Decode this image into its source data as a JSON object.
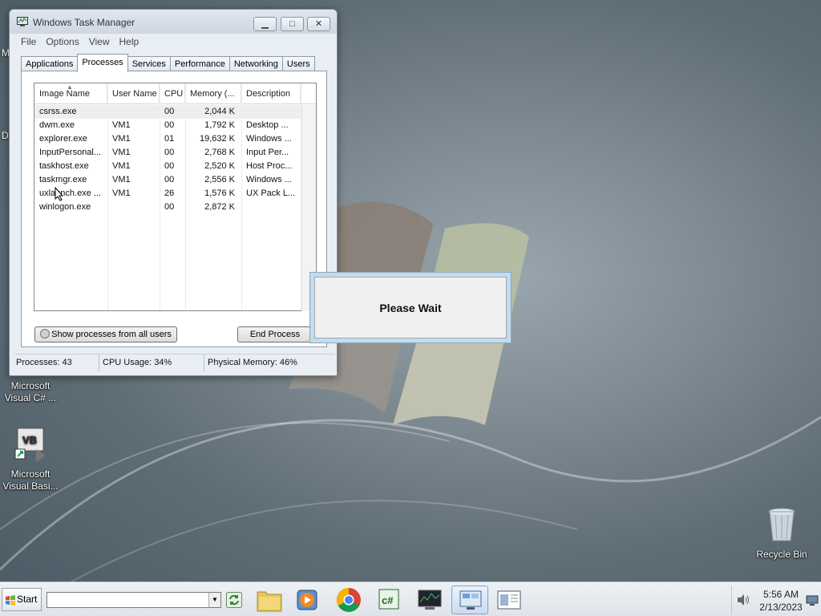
{
  "window": {
    "title": "Windows Task Manager",
    "minimize_label": "▁",
    "maximize_label": "□",
    "close_label": "✕"
  },
  "menu": [
    "File",
    "Options",
    "View",
    "Help"
  ],
  "tabs": [
    {
      "label": "Applications",
      "active": false
    },
    {
      "label": "Processes",
      "active": true
    },
    {
      "label": "Services",
      "active": false
    },
    {
      "label": "Performance",
      "active": false
    },
    {
      "label": "Networking",
      "active": false
    },
    {
      "label": "Users",
      "active": false
    }
  ],
  "process_table": {
    "columns": [
      "Image Name",
      "User Name",
      "CPU",
      "Memory (...",
      "Description"
    ],
    "sort_indicator": "▲",
    "rows": [
      {
        "name": "csrss.exe",
        "user": "",
        "cpu": "00",
        "memory": "2,044 K",
        "description": ""
      },
      {
        "name": "dwm.exe",
        "user": "VM1",
        "cpu": "00",
        "memory": "1,792 K",
        "description": "Desktop ..."
      },
      {
        "name": "explorer.exe",
        "user": "VM1",
        "cpu": "01",
        "memory": "19,632 K",
        "description": "Windows ..."
      },
      {
        "name": "InputPersonal...",
        "user": "VM1",
        "cpu": "00",
        "memory": "2,768 K",
        "description": "Input Per..."
      },
      {
        "name": "taskhost.exe",
        "user": "VM1",
        "cpu": "00",
        "memory": "2,520 K",
        "description": "Host Proc..."
      },
      {
        "name": "taskmgr.exe",
        "user": "VM1",
        "cpu": "00",
        "memory": "2,556 K",
        "description": "Windows ..."
      },
      {
        "name": "uxlaunch.exe ...",
        "user": "VM1",
        "cpu": "26",
        "memory": "1,576 K",
        "description": "UX Pack L..."
      },
      {
        "name": "winlogon.exe",
        "user": "",
        "cpu": "00",
        "memory": "2,872 K",
        "description": ""
      }
    ]
  },
  "buttons": {
    "show_all": "Show processes from all users",
    "end_process": "End Process"
  },
  "status": {
    "processes": "Processes: 43",
    "cpu": "CPU Usage: 34%",
    "memory": "Physical Memory: 46%"
  },
  "dialog": {
    "text": "Please Wait"
  },
  "desktop": {
    "icons": [
      {
        "label_line1": "Microsoft",
        "label_line2": "Visual C# ..."
      },
      {
        "label_line1": "Microsoft",
        "label_line2": "Visual Basi..."
      },
      {
        "label_line1": "Recycle Bin",
        "label_line2": ""
      }
    ],
    "edge_letters": [
      "M",
      "D"
    ]
  },
  "taskbar": {
    "start_label": "Start",
    "address_value": "",
    "dropdown_glyph": "▼",
    "apps": [
      {
        "icon": "folder-icon",
        "active": false
      },
      {
        "icon": "media-player-icon",
        "active": false
      },
      {
        "icon": "chrome-icon",
        "active": false
      },
      {
        "icon": "csharp-icon",
        "active": false
      },
      {
        "icon": "task-manager-icon",
        "active": false
      },
      {
        "icon": "remote-desktop-icon",
        "active": true
      },
      {
        "icon": "document-icon",
        "active": false
      }
    ],
    "clock_time": "5:56 AM",
    "clock_date": "2/13/2023"
  },
  "colors": {
    "selection": "#3399ff",
    "dialog_border": "#c6dbea",
    "wallpaper": "#7f8b92"
  }
}
